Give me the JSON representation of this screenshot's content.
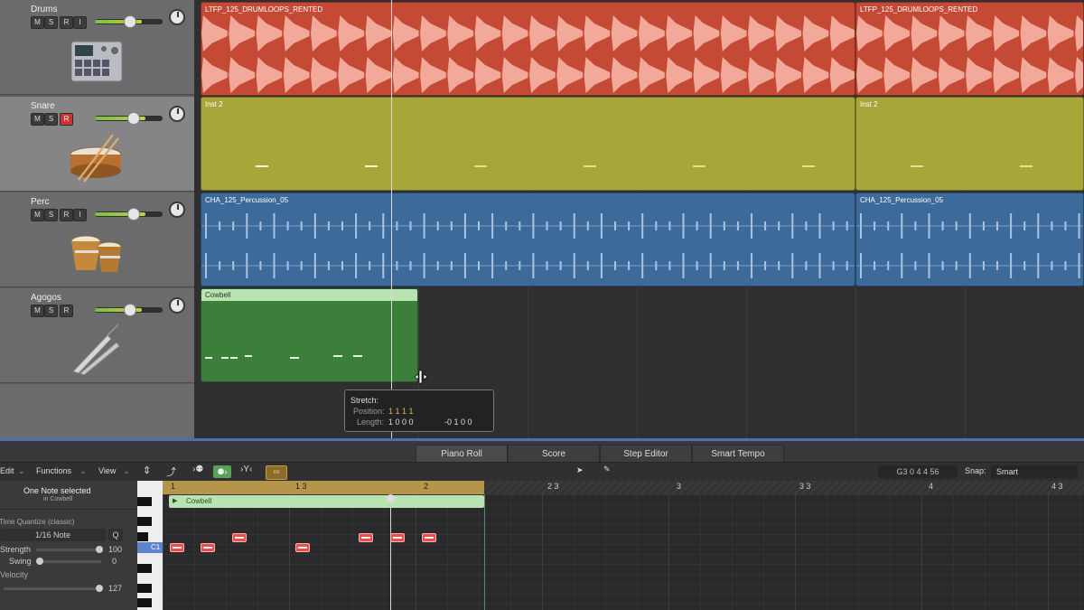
{
  "tracks": [
    {
      "name": "Drums",
      "mute": "M",
      "solo": "S",
      "record": "R",
      "input": "I",
      "icon": "drum-machine-icon",
      "fader_level": 0.52
    },
    {
      "name": "Snare",
      "mute": "M",
      "solo": "S",
      "record": "R",
      "icon": "snare-drum-icon",
      "fader_level": 0.56,
      "record_active": true
    },
    {
      "name": "Perc",
      "mute": "M",
      "solo": "S",
      "record": "R",
      "input": "I",
      "icon": "bongos-icon",
      "fader_level": 0.56
    },
    {
      "name": "Agogos",
      "mute": "M",
      "solo": "S",
      "record": "R",
      "icon": "agogo-bell-icon",
      "fader_level": 0.52
    }
  ],
  "regions": {
    "drums_a": "LTFP_125_DRUMLOOPS_RENTED",
    "drums_b": "LTFP_125_DRUMLOOPS_RENTED",
    "inst_a": "Inst 2",
    "inst_b": "Inst 2",
    "perc_a": "CHA_125_Percussion_05",
    "perc_b": "CHA_125_Percussion_05",
    "cowbell": "Cowbell"
  },
  "colors": {
    "drums": "#c44a36",
    "inst": "#a8a63a",
    "perc": "#3c6a9b",
    "cowbell": "#3b7f3a",
    "cowbell_header": "#b9e3b2"
  },
  "tooltip": {
    "title": "Stretch:",
    "position_label": "Position:",
    "position_value": "1 1 1 1",
    "length_label": "Length:",
    "length_value": "1 0 0 0",
    "delta_value": "-0 1 0 0"
  },
  "editor_tabs": [
    "Piano Roll",
    "Score",
    "Step Editor",
    "Smart Tempo"
  ],
  "editor_toolbar": {
    "edit": "Edit",
    "functions": "Functions",
    "view": "View",
    "position_readout": "G3  0 4 4 56",
    "snap_label": "Snap:",
    "snap_value": "Smart"
  },
  "inspector": {
    "selection": "One Note selected",
    "selection_sub": "in Cowbell",
    "quantize_title": "Time Quantize (classic)",
    "quantize_value": "1/16 Note",
    "q_button": "Q",
    "strength_label": "Strength",
    "strength_value": "100",
    "swing_label": "Swing",
    "swing_value": "0",
    "velocity_label": "Velocity",
    "velocity_value": "127"
  },
  "ruler": {
    "marks": [
      "1",
      "1 3",
      "2",
      "2 3",
      "3",
      "3 3",
      "4",
      "4 3"
    ]
  },
  "keyboard": {
    "c_label": "C1"
  },
  "piano_roll_region": "Cowbell"
}
